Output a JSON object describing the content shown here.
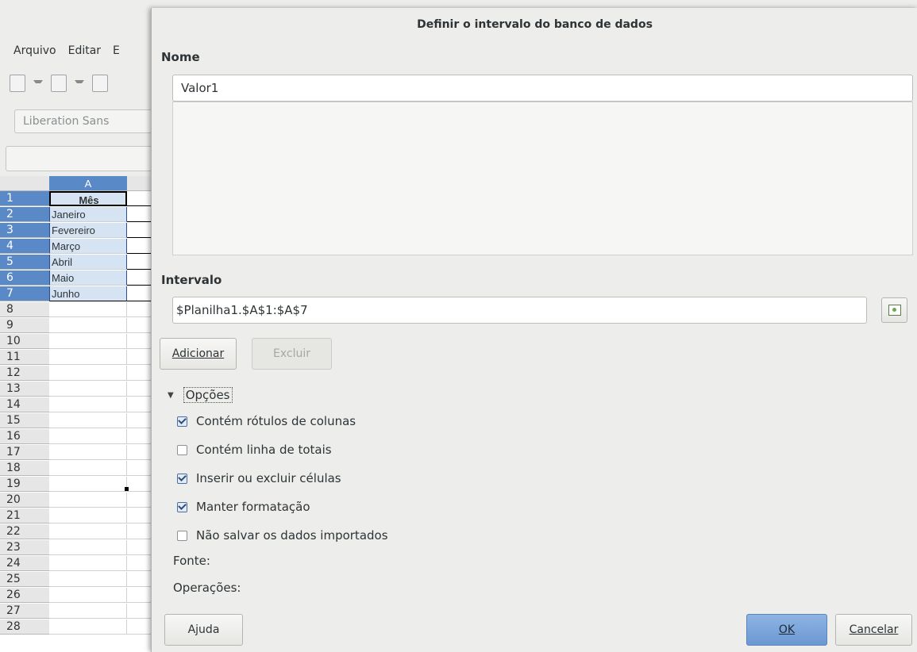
{
  "app": {
    "menu": [
      "Arquivo",
      "Editar",
      "E"
    ],
    "font_name": "Liberation Sans",
    "column_header": "A",
    "rows": [
      {
        "num": "1",
        "value": "Mês",
        "selected": true,
        "header": true
      },
      {
        "num": "2",
        "value": "Janeiro",
        "selected": true
      },
      {
        "num": "3",
        "value": "Fevereiro",
        "selected": true
      },
      {
        "num": "4",
        "value": "Março",
        "selected": true
      },
      {
        "num": "5",
        "value": "Abril",
        "selected": true
      },
      {
        "num": "6",
        "value": "Maio",
        "selected": true
      },
      {
        "num": "7",
        "value": "Junho",
        "selected": true
      },
      {
        "num": "8",
        "value": ""
      },
      {
        "num": "9",
        "value": ""
      },
      {
        "num": "10",
        "value": ""
      },
      {
        "num": "11",
        "value": ""
      },
      {
        "num": "12",
        "value": ""
      },
      {
        "num": "13",
        "value": ""
      },
      {
        "num": "14",
        "value": ""
      },
      {
        "num": "15",
        "value": ""
      },
      {
        "num": "16",
        "value": ""
      },
      {
        "num": "17",
        "value": ""
      },
      {
        "num": "18",
        "value": ""
      },
      {
        "num": "19",
        "value": ""
      },
      {
        "num": "20",
        "value": ""
      },
      {
        "num": "21",
        "value": ""
      },
      {
        "num": "22",
        "value": ""
      },
      {
        "num": "23",
        "value": ""
      },
      {
        "num": "24",
        "value": ""
      },
      {
        "num": "25",
        "value": ""
      },
      {
        "num": "26",
        "value": ""
      },
      {
        "num": "27",
        "value": ""
      },
      {
        "num": "28",
        "value": ""
      }
    ]
  },
  "dialog": {
    "title": "Definir o intervalo do banco de dados",
    "name_label": "Nome",
    "name_value": "Valor1",
    "range_label": "Intervalo",
    "range_value": "$Planilha1.$A$1:$A$7",
    "add_button": "Adicionar",
    "delete_button": "Excluir",
    "options_label": "Opções",
    "options": [
      {
        "label": "Contém rótulos de colunas",
        "checked": true
      },
      {
        "label": "Contém linha de totais",
        "checked": false
      },
      {
        "label": "Inserir ou excluir células",
        "checked": true
      },
      {
        "label": "Manter formatação",
        "checked": true
      },
      {
        "label": "Não salvar os dados importados",
        "checked": false
      }
    ],
    "source_label": "Fonte:",
    "operations_label": "Operações:",
    "help_button": "Ajuda",
    "ok_button": "OK",
    "cancel_button": "Cancelar"
  }
}
